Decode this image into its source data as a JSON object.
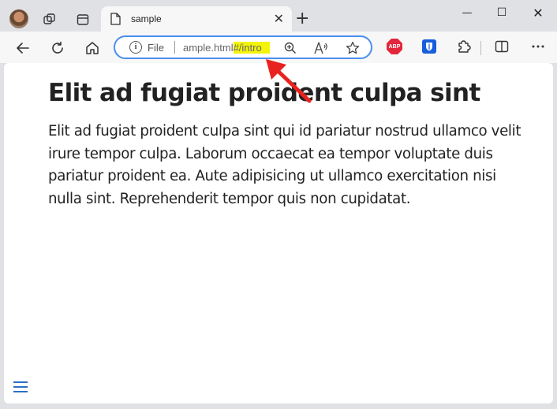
{
  "tab": {
    "title": "sample",
    "close_glyph": "✕"
  },
  "new_tab_glyph": "+",
  "window_controls": {
    "minimize_glyph": "—",
    "maximize_glyph": "☐",
    "close_glyph": "✕"
  },
  "address_bar": {
    "scheme_label": "File",
    "url_main": "ample.html",
    "url_hash": "#/intro"
  },
  "extensions": {
    "abp_label": "ABP"
  },
  "page": {
    "heading": "Elit ad fugiat proident culpa sint",
    "paragraph": "Elit ad fugiat proident culpa sint qui id pariatur nostrud ullamco velit irure tempor culpa. Laborum occaecat ea tempor voluptate duis pariatur proident ea. Aute adipisicing ut ullamco exercitation nisi nulla sint. Reprehenderit tempor quis non cupidatat."
  },
  "colors": {
    "address_focus_ring": "#4a8ef0",
    "hash_highlight": "#f4f40a",
    "annotation_arrow": "#e8231f",
    "menu_icon": "#2b6fc4"
  },
  "icons": {
    "back": "back-arrow-icon",
    "refresh": "refresh-icon",
    "home": "home-icon",
    "info": "info-icon",
    "zoom": "zoom-in-icon",
    "read_aloud": "read-aloud-icon",
    "favorite": "star-icon",
    "extensions": "puzzle-icon",
    "split_screen": "split-screen-icon",
    "more": "more-icon",
    "menu": "hamburger-menu-icon"
  }
}
